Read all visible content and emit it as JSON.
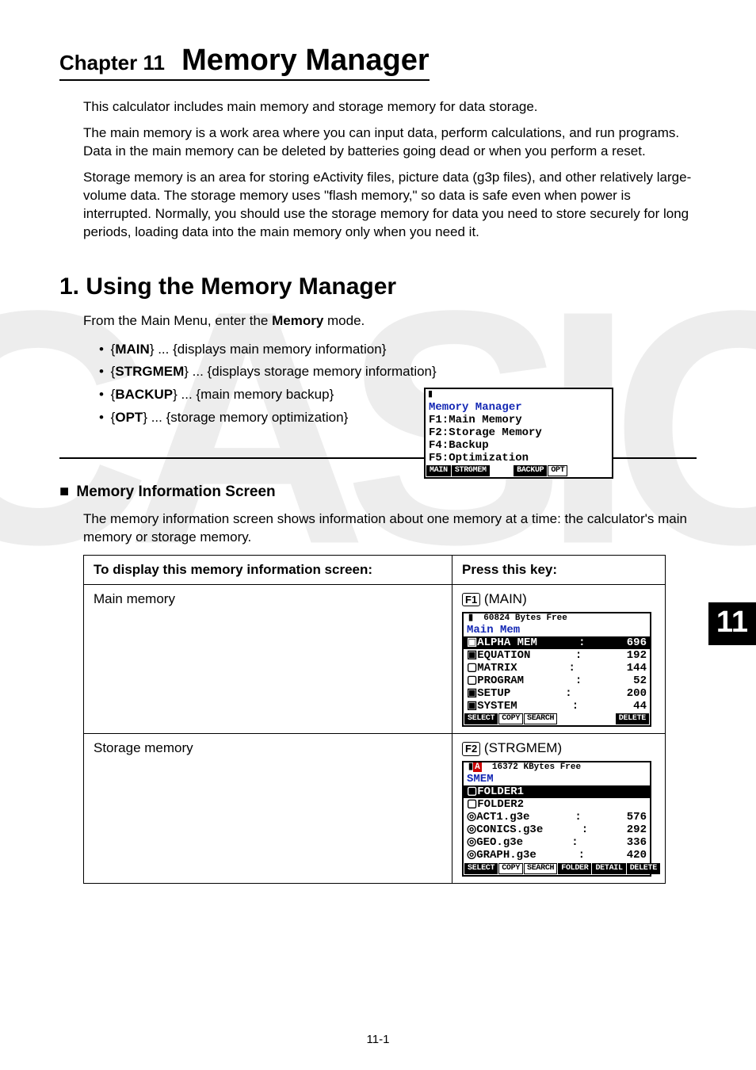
{
  "watermark": "CASIO",
  "chapter": {
    "prefix": "Chapter 11",
    "title": "Memory Manager"
  },
  "intro": {
    "p1": "This calculator includes main memory and storage memory for data storage.",
    "p2": "The main memory is a work area where you can input data, perform calculations, and run programs. Data in the main memory can be deleted by batteries going dead or when you perform a reset.",
    "p3": "Storage memory is an area for storing eActivity files, picture data (g3p files), and other relatively large-volume data. The storage memory uses \"flash memory,\" so data is safe even when power is interrupted. Normally, you should use the storage memory for data you need to store securely for long periods, loading data into the main memory only when you need it."
  },
  "section1": {
    "title": "1. Using the Memory Manager",
    "lead_before": "From the Main Menu, enter the ",
    "lead_bold": "Memory",
    "lead_after": " mode.",
    "items": [
      {
        "key": "MAIN",
        "desc": "displays main memory information"
      },
      {
        "key": "STRGMEM",
        "desc": "displays storage memory information"
      },
      {
        "key": "BACKUP",
        "desc": "main memory backup"
      },
      {
        "key": "OPT",
        "desc": "storage memory optimization"
      }
    ]
  },
  "calc_top": {
    "title": "Memory Manager",
    "lines": [
      "F1:Main Memory",
      "F2:Storage Memory",
      "",
      "F4:Backup",
      "F5:Optimization"
    ],
    "softkeys": [
      "MAIN",
      "STRGMEM",
      "",
      "",
      "BACKUP",
      "OPT"
    ]
  },
  "subsection": {
    "title": "Memory Information Screen",
    "desc": "The memory information screen shows information about one memory at a time: the calculator's main memory or storage memory."
  },
  "table": {
    "h1": "To display this memory information screen:",
    "h2": "Press this key:",
    "rows": [
      {
        "label": "Main memory",
        "key": "F1",
        "keylabel": "(MAIN)"
      },
      {
        "label": "Storage memory",
        "key": "F2",
        "keylabel": "(STRGMEM)"
      }
    ]
  },
  "calc_main": {
    "status": "60824 Bytes Free",
    "title": "Main Mem",
    "rows": [
      {
        "name": "▣ALPHA MEM",
        "val": "696",
        "hl": true
      },
      {
        "name": "▣EQUATION",
        "val": "192"
      },
      {
        "name": "▢MATRIX",
        "val": "144"
      },
      {
        "name": "▢PROGRAM",
        "val": "52"
      },
      {
        "name": "▣SETUP",
        "val": "200"
      },
      {
        "name": "▣SYSTEM",
        "val": "44"
      }
    ],
    "softkeys": [
      "SELECT",
      "COPY",
      "SEARCH",
      "",
      "",
      "DELETE"
    ]
  },
  "calc_strg": {
    "status": "16372 KBytes Free",
    "title": "SMEM",
    "rows": [
      {
        "name": "▢FOLDER1",
        "val": "",
        "hl": true
      },
      {
        "name": "▢FOLDER2",
        "val": ""
      },
      {
        "name": "◎ACT1.g3e",
        "val": "576"
      },
      {
        "name": "◎CONICS.g3e",
        "val": "292"
      },
      {
        "name": "◎GEO.g3e",
        "val": "336"
      },
      {
        "name": "◎GRAPH.g3e",
        "val": "420"
      }
    ],
    "softkeys": [
      "SELECT",
      "COPY",
      "SEARCH",
      "FOLDER",
      "DETAIL",
      "DELETE"
    ]
  },
  "page_tab": "11",
  "page_number": "11-1"
}
